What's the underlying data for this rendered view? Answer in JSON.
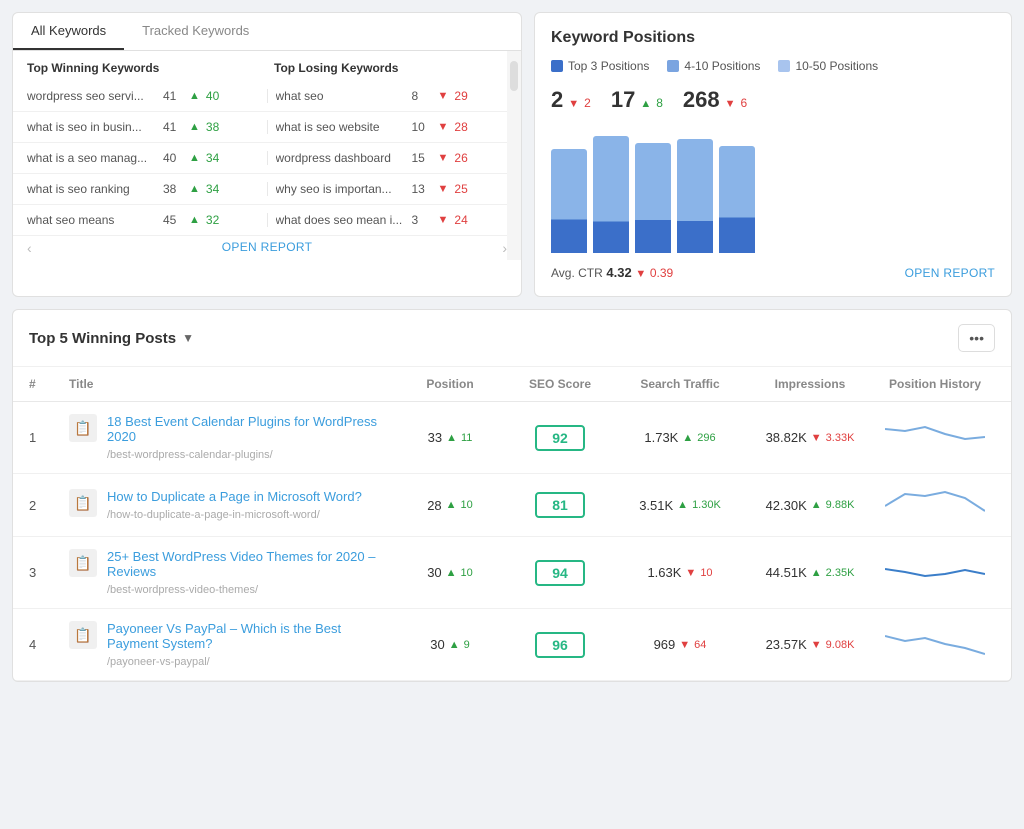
{
  "tabs": {
    "all_keywords": "All Keywords",
    "tracked_keywords": "Tracked Keywords"
  },
  "keywords_panel": {
    "col_winning": "Top Winning Keywords",
    "col_losing": "Top Losing Keywords",
    "winning_rows": [
      {
        "name": "wordpress seo servi...",
        "position": "41",
        "change": "40",
        "direction": "up"
      },
      {
        "name": "what is seo in busin...",
        "position": "41",
        "change": "38",
        "direction": "up"
      },
      {
        "name": "what is a seo manag...",
        "position": "40",
        "change": "34",
        "direction": "up"
      },
      {
        "name": "what is seo ranking",
        "position": "38",
        "change": "34",
        "direction": "up"
      },
      {
        "name": "what seo means",
        "position": "45",
        "change": "32",
        "direction": "up"
      }
    ],
    "losing_rows": [
      {
        "name": "what seo",
        "position": "8",
        "change": "29",
        "direction": "down"
      },
      {
        "name": "what is seo website",
        "position": "10",
        "change": "28",
        "direction": "down"
      },
      {
        "name": "wordpress dashboard",
        "position": "15",
        "change": "26",
        "direction": "down"
      },
      {
        "name": "why seo is importan...",
        "position": "13",
        "change": "25",
        "direction": "down"
      },
      {
        "name": "what does seo mean i...",
        "position": "3",
        "change": "24",
        "direction": "down"
      }
    ],
    "open_report": "OPEN REPORT"
  },
  "positions_panel": {
    "title": "Keyword Positions",
    "legend": {
      "top3": "Top 3 Positions",
      "pos4_10": "4-10 Positions",
      "pos10_50": "10-50 Positions"
    },
    "stats": [
      {
        "num": "2",
        "change": "2",
        "direction": "down"
      },
      {
        "num": "17",
        "change": "8",
        "direction": "up"
      },
      {
        "num": "268",
        "change": "6",
        "direction": "down"
      }
    ],
    "ctr_label": "Avg. CTR",
    "ctr_value": "4.32",
    "ctr_change": "0.39",
    "ctr_direction": "down",
    "open_report": "OPEN REPORT",
    "bars": [
      {
        "top_pct": 68,
        "bottom_pct": 32
      },
      {
        "top_pct": 75,
        "bottom_pct": 25
      },
      {
        "top_pct": 72,
        "bottom_pct": 28
      },
      {
        "top_pct": 70,
        "bottom_pct": 30
      },
      {
        "top_pct": 65,
        "bottom_pct": 35
      }
    ]
  },
  "posts_panel": {
    "title": "Top 5 Winning Posts",
    "more_btn": "•••",
    "columns": {
      "num": "#",
      "title": "Title",
      "position": "Position",
      "seo_score": "SEO Score",
      "traffic": "Search Traffic",
      "impressions": "Impressions",
      "history": "Position History"
    },
    "rows": [
      {
        "num": "1",
        "title": "18 Best Event Calendar Plugins for WordPress 2020",
        "url": "/best-wordpress-calendar-plugins/",
        "position": "33",
        "pos_change": "11",
        "pos_direction": "up",
        "seo_score": "92",
        "traffic": "1.73K",
        "traffic_change": "296",
        "traffic_direction": "up",
        "impressions": "38.82K",
        "imp_change": "3.33K",
        "imp_direction": "down"
      },
      {
        "num": "2",
        "title": "How to Duplicate a Page in Microsoft Word?",
        "url": "/how-to-duplicate-a-page-in-microsoft-word/",
        "position": "28",
        "pos_change": "10",
        "pos_direction": "up",
        "seo_score": "81",
        "traffic": "3.51K",
        "traffic_change": "1.30K",
        "traffic_direction": "up",
        "impressions": "42.30K",
        "imp_change": "9.88K",
        "imp_direction": "up"
      },
      {
        "num": "3",
        "title": "25+ Best WordPress Video Themes for 2020 – Reviews",
        "url": "/best-wordpress-video-themes/",
        "position": "30",
        "pos_change": "10",
        "pos_direction": "up",
        "seo_score": "94",
        "traffic": "1.63K",
        "traffic_change": "10",
        "traffic_direction": "down",
        "impressions": "44.51K",
        "imp_change": "2.35K",
        "imp_direction": "up"
      },
      {
        "num": "4",
        "title": "Payoneer Vs PayPal – Which is the Best Payment System?",
        "url": "/payoneer-vs-paypal/",
        "position": "30",
        "pos_change": "9",
        "pos_direction": "up",
        "seo_score": "96",
        "traffic": "969",
        "traffic_change": "64",
        "traffic_direction": "down",
        "impressions": "23.57K",
        "imp_change": "9.08K",
        "imp_direction": "down"
      }
    ]
  }
}
